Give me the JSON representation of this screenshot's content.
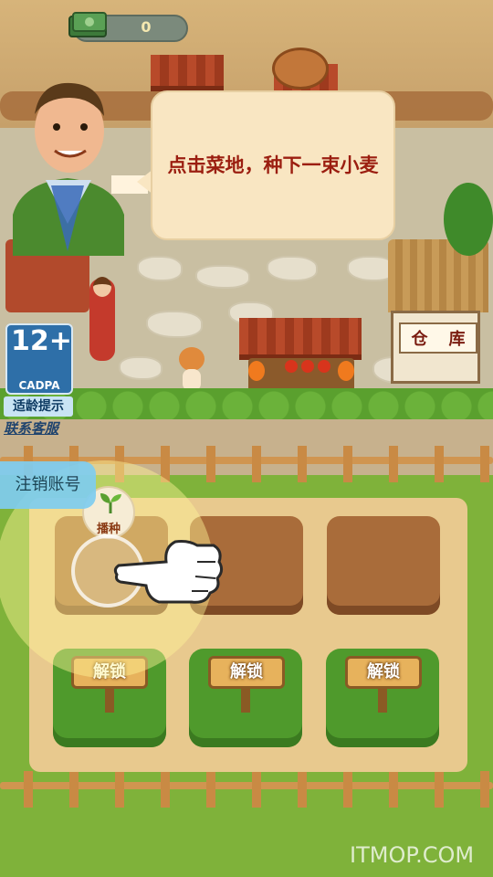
{
  "hud": {
    "money_value": "0"
  },
  "tutorial": {
    "speech": "点击菜地，种下一束小麦"
  },
  "rating": {
    "age": "12+",
    "org": "CADPA",
    "tip": "适龄提示"
  },
  "links": {
    "support": "联系客服",
    "logout": "注销账号"
  },
  "plots": {
    "seed_label": "播种",
    "unlock_label": "解锁",
    "dirt_count": 3,
    "locked_count": 3
  },
  "buildings": {
    "warehouse_sign": [
      "仓",
      "库"
    ]
  },
  "watermark": "ITMOP.COM"
}
